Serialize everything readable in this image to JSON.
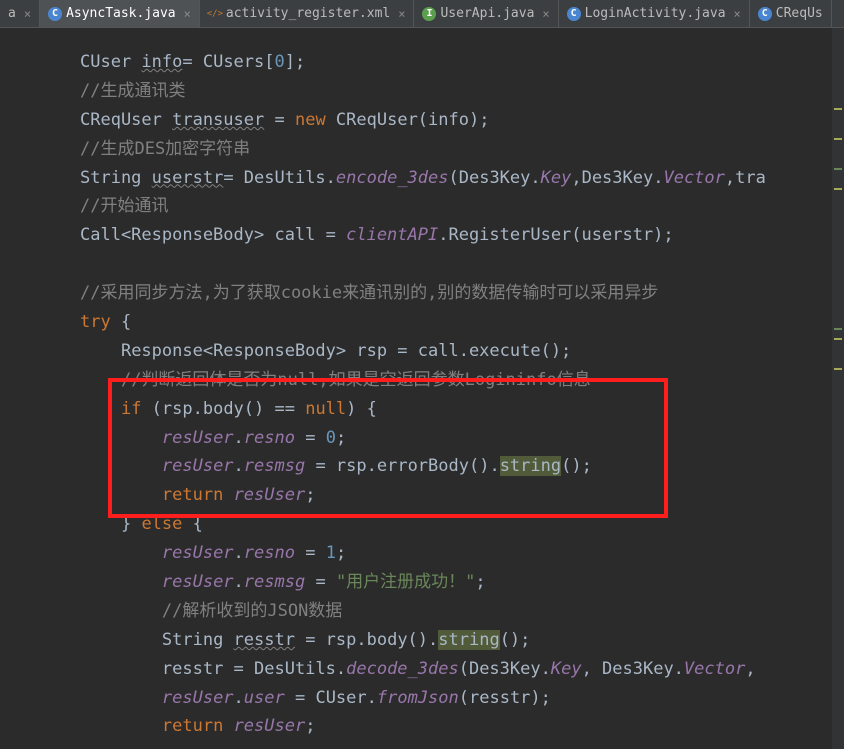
{
  "tabs": {
    "t0": {
      "label": "a",
      "icon": ""
    },
    "t1": {
      "label": "AsyncTask.java",
      "icon": "C"
    },
    "t2": {
      "label": "activity_register.xml",
      "icon": "X"
    },
    "t3": {
      "label": "UserApi.java",
      "icon": "I"
    },
    "t4": {
      "label": "LoginActivity.java",
      "icon": "C"
    },
    "t5": {
      "label": "CReqUs",
      "icon": "C"
    }
  },
  "code": {
    "l1a": "CUser ",
    "l1b": "info",
    "l1c": "= CUsers[",
    "l1d": "0",
    "l1e": "];",
    "l2": "//生成通讯类",
    "l3a": "CReqUser ",
    "l3b": "transuser",
    "l3c": " = ",
    "l3d": "new",
    "l3e": " CReqUser(info);",
    "l4": "//生成DES加密字符串",
    "l5a": "String ",
    "l5b": "userstr",
    "l5c": "= DesUtils.",
    "l5d": "encode_3des",
    "l5e": "(Des3Key.",
    "l5f": "Key",
    "l5g": ",Des3Key.",
    "l5h": "Vector",
    "l5i": ",tra",
    "l6": "//开始通讯",
    "l7a": "Call<ResponseBody> call = ",
    "l7b": "clientAPI",
    "l7c": ".RegisterUser(userstr);",
    "l8": "//采用同步方法,为了获取cookie来通讯别的,别的数据传输时可以采用异步",
    "l9a": "try",
    "l9b": " {",
    "l10a": "Response<ResponseBody> rsp = call.execute();",
    "l11": "//判断返回体是否为null,如果是空返回参数Logininfo信息",
    "l12a": "if",
    "l12b": " (rsp.body() == ",
    "l12c": "null",
    "l12d": ") {",
    "l13a": "resUser",
    "l13b": ".",
    "l13c": "resno",
    "l13d": " = ",
    "l13e": "0",
    "l13f": ";",
    "l14a": "resUser",
    "l14b": ".",
    "l14c": "resmsg",
    "l14d": " = rsp.errorBody().",
    "l14e": "string",
    "l14f": "();",
    "l15a": "return",
    "l15b": " ",
    "l15c": "resUser",
    "l15d": ";",
    "l16a": "} ",
    "l16b": "else",
    "l16c": " {",
    "l17a": "resUser",
    "l17b": ".",
    "l17c": "resno",
    "l17d": " = ",
    "l17e": "1",
    "l17f": ";",
    "l18a": "resUser",
    "l18b": ".",
    "l18c": "resmsg",
    "l18d": " = ",
    "l18e": "\"用户注册成功！\"",
    "l18f": ";",
    "l19": "//解析收到的JSON数据",
    "l20a": "String ",
    "l20b": "resstr",
    "l20c": " = rsp.body().",
    "l20d": "string",
    "l20e": "();",
    "l21a": "resstr = DesUtils.",
    "l21b": "decode_3des",
    "l21c": "(Des3Key.",
    "l21d": "Key",
    "l21e": ", Des3Key.",
    "l21f": "Vector",
    "l21g": ",",
    "l22a": "resUser",
    "l22b": ".",
    "l22c": "user",
    "l22d": " = CUser.",
    "l22e": "fromJson",
    "l22f": "(resstr);",
    "l23a": "return",
    "l23b": " ",
    "l23c": "resUser",
    "l23d": ";"
  }
}
